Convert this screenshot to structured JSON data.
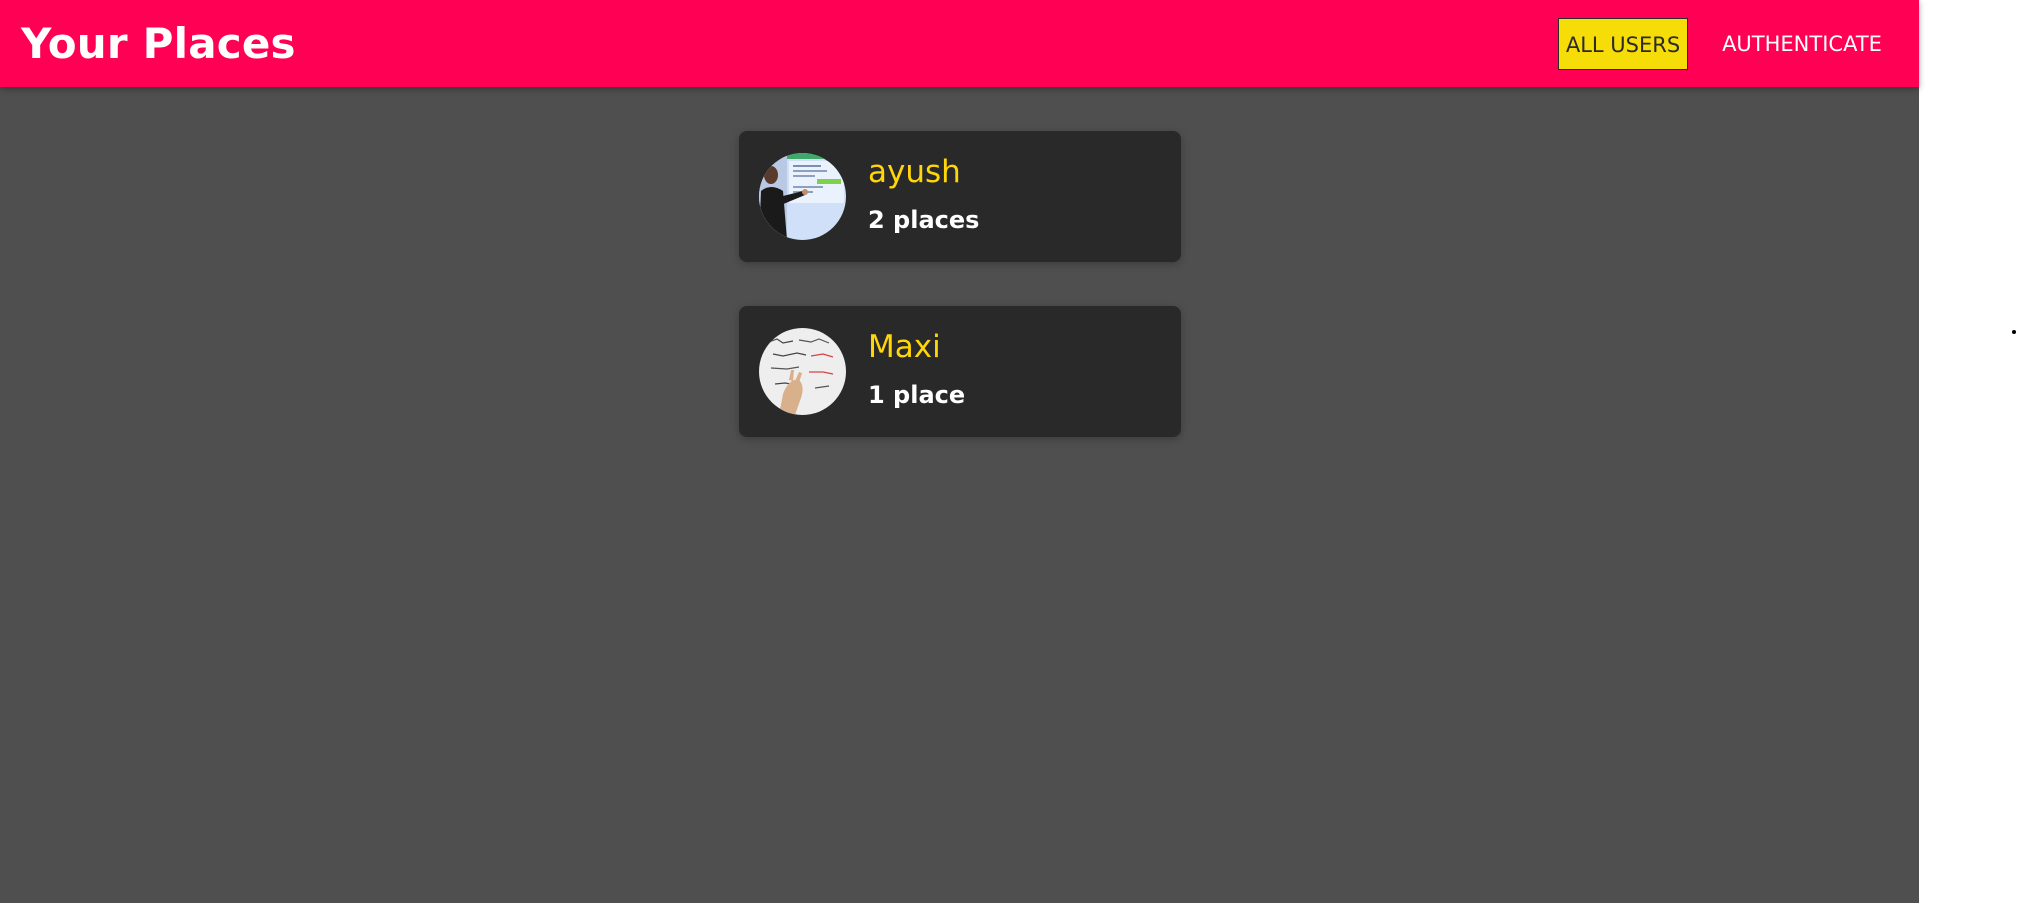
{
  "header": {
    "title": "Your Places",
    "nav": {
      "all_users": "ALL USERS",
      "authenticate": "AUTHENTICATE"
    }
  },
  "users": [
    {
      "name": "ayush",
      "places": "2 places",
      "avatar": "presenter-at-whiteboard-photo"
    },
    {
      "name": "Maxi",
      "places": "1 place",
      "avatar": "hand-on-whiteboard-photo"
    }
  ],
  "colors": {
    "header_bg": "#ff0055",
    "page_bg": "#4f4f4f",
    "card_bg": "#292929",
    "name_text": "#ffd60a",
    "active_nav_bg": "#f6dd07"
  }
}
